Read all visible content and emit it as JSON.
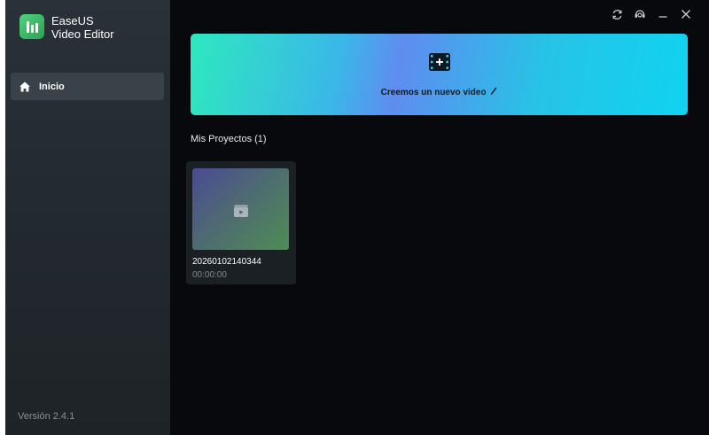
{
  "app": {
    "name_line1": "EaseUS",
    "name_line2": "Video Editor",
    "version": "Versión 2.4.1"
  },
  "sidebar": {
    "items": [
      {
        "label": "Inicio",
        "icon": "home-icon",
        "active": true
      }
    ]
  },
  "window_controls": [
    "refresh-icon",
    "support-icon",
    "minimize-icon",
    "close-icon"
  ],
  "banner": {
    "label": "Creemos un nuevo video",
    "icon": "film-plus-icon",
    "accent_colors": [
      "#2ee8bf",
      "#5f8cf0",
      "#10d3f0"
    ]
  },
  "projects": {
    "title": "Mis Proyectos (1)",
    "items": [
      {
        "name": "20260102140344",
        "duration": "00:00:00",
        "icon": "clapper-play-icon"
      }
    ]
  }
}
